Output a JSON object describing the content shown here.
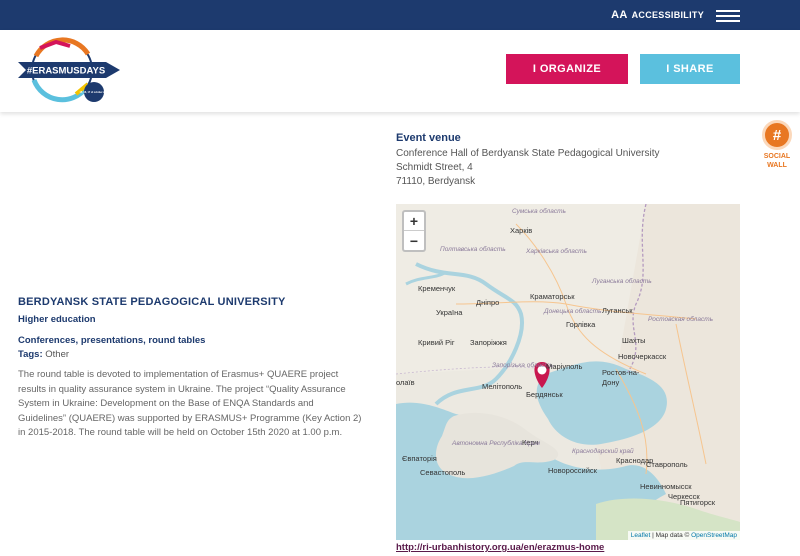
{
  "topbar": {
    "accessibility_icon": "AA",
    "accessibility_label": "ACCESSIBILITY"
  },
  "header": {
    "logo_text": "#ERASMUSDAYS",
    "logo_dates": "15, 16, 17 of october 2020",
    "organize_label": "I ORGANIZE",
    "share_label": "I SHARE"
  },
  "social": {
    "label_line1": "SOCIAL",
    "label_line2": "WALL"
  },
  "venue": {
    "title": "Event venue",
    "line1": "Conference Hall of Berdyansk State Pedagogical University",
    "line2": "Schmidt Street, 4",
    "line3": "71110, Berdyansk"
  },
  "event": {
    "org_name": "BERDYANSK STATE PEDAGOGICAL UNIVERSITY",
    "org_type": "Higher education",
    "event_type": "Conferences, presentations, round tables",
    "tags_label": "Tags:",
    "tags_value": "Other",
    "description": "The round table is devoted to implementation of Erasmus+ QUAERE project results in quality assurance system in Ukraine. The project “Quality Assurance System in Ukraine: Development on the Base of ENQA Standards and Guidelines” (QUAERE) was supported by ERASMUS+ Programme (Key Action 2) in 2015-2018. The round table will be held on October 15th 2020 at 1.00 p.m."
  },
  "map": {
    "zoom_in": "+",
    "zoom_out": "−",
    "cities": {
      "kharkiv": "Харків",
      "kremenchuk": "Кременчук",
      "dnipro": "Дніпро",
      "kramatorsk": "Краматорськ",
      "luhansk": "Луганськ",
      "ukraina": "Україна",
      "horlivka": "Горлівка",
      "shakhty": "Шахты",
      "kryvyi_rih": "Кривий Ріг",
      "zaporizhzhia": "Запоріжжя",
      "novocherkassk": "Новочеркасск",
      "mariupol": "Маріуполь",
      "rostov": "Ростов-на-Дону",
      "melitopol": "Мелітополь",
      "berdiansk": "Бердянськ",
      "kerch": "Керч",
      "yevpatoriia": "Євпаторія",
      "sevastopol": "Севастополь",
      "novorossiysk": "Новороссийск",
      "stavropol": "Ставрополь",
      "olaiv": "олаїв",
      "krasnodar": "Краснодар",
      "nevinnomyssk": "Невинномысск",
      "pyatigorsk": "Пятигорск",
      "cherkessk": "Черкесск"
    },
    "regions": {
      "sumska": "Сумська область",
      "kharkivska": "Харківська область",
      "poltavska": "Полтавська область",
      "luhanska": "Луганська область",
      "donetska": "Донецька область",
      "rostovskaya": "Ростовская область",
      "zaporizka": "Запорізька область",
      "krym": "Автономна Республіка Крим",
      "krasnodarskiy": "Краснодарский край"
    },
    "attribution_leaflet": "Leaflet",
    "attribution_mid": " | Map data © ",
    "attribution_osm": "OpenStreetMap"
  },
  "footer_link": "http://ri-urbanhistory.org.ua/en/erazmus-home",
  "colors": {
    "navy": "#1d3a6e",
    "magenta": "#d4145a",
    "cyan": "#5bc0de",
    "orange": "#e87722"
  }
}
